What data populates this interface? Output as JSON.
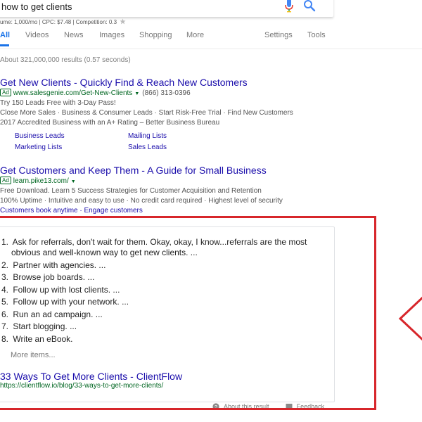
{
  "search": {
    "query": "how to get clients",
    "keyword_stats": "ume: 1,000/mo | CPC: $7.48 | Competition: 0.3"
  },
  "tabs": [
    {
      "label": "All",
      "active": true
    },
    {
      "label": "Videos"
    },
    {
      "label": "News"
    },
    {
      "label": "Images"
    },
    {
      "label": "Shopping"
    },
    {
      "label": "More"
    }
  ],
  "tools": {
    "settings": "Settings",
    "tools": "Tools"
  },
  "result_stats": "About 321,000,000 results (0.57 seconds)",
  "ads": [
    {
      "title": "Get New Clients - Quickly Find & Reach New Customers",
      "badge": "Ad",
      "url": "www.salesgenie.com/Get-New-Clients",
      "phone": "(866) 313-0396",
      "lines": [
        "Try 150 Leads Free with 3-Day Pass!",
        "Close More Sales · Business & Consumer Leads · Start Risk-Free Trial · Find New Customers",
        "2017 Accredited Business with an A+ Rating – Better Business Bureau"
      ],
      "sitelinks": [
        "Business Leads",
        "Mailing Lists",
        "Marketing Lists",
        "Sales Leads"
      ]
    },
    {
      "title": "Get Customers and Keep Them - A Guide for Small Business",
      "badge": "Ad",
      "url": "learn.pike13.com/",
      "lines": [
        "Free Download. Learn 5 Success Strategies for Customer Acquisition and Retention",
        "100% Uptime · Intuitive and easy to use · No credit card required · Highest level of security"
      ],
      "links": [
        "Customers book anytime",
        "Engage customers"
      ]
    }
  ],
  "snippet": {
    "items": [
      {
        "num": "1.",
        "text": "Ask for referrals, don't wait for them. Okay, okay, I know...referrals are the most",
        "cont": "obvious and well-known way to get new clients. ..."
      },
      {
        "num": "2.",
        "text": "Partner with agencies. ..."
      },
      {
        "num": "3.",
        "text": "Browse job boards. ..."
      },
      {
        "num": "4.",
        "text": "Follow up with lost clients. ..."
      },
      {
        "num": "5.",
        "text": "Follow up with your network. ..."
      },
      {
        "num": "6.",
        "text": "Run an ad campaign. ..."
      },
      {
        "num": "7.",
        "text": "Start blogging. ..."
      },
      {
        "num": "8.",
        "text": "Write an eBook."
      }
    ],
    "more_items": "More items...",
    "title": "33 Ways To Get More Clients - ClientFlow",
    "url": "https://clientflow.io/blog/33-ways-to-get-more-clients/",
    "about": "About this result",
    "feedback": "Feedback"
  },
  "colors": {
    "link": "#1a0dab",
    "url_green": "#006621",
    "tab_active": "#1a73e8",
    "annotation_red": "#d7262b"
  }
}
